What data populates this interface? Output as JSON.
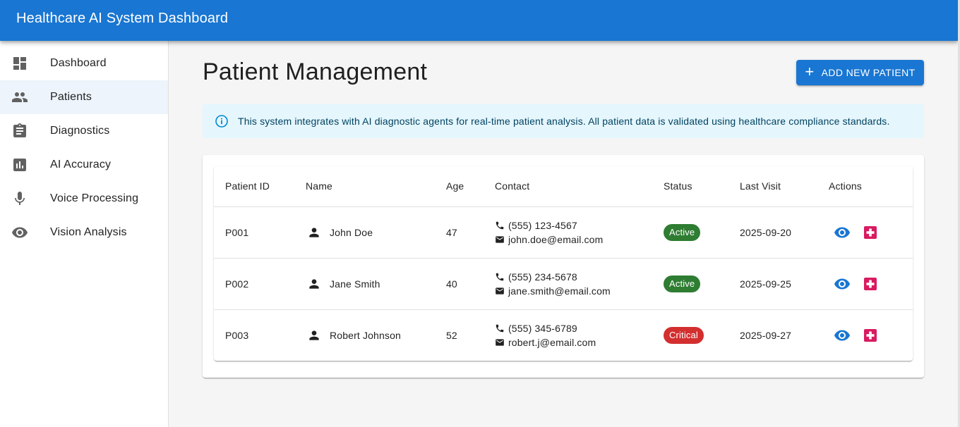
{
  "app": {
    "title": "Healthcare AI System Dashboard"
  },
  "colors": {
    "primary": "#1976d2",
    "active": "#2e7d32",
    "critical": "#d32f2f",
    "medical": "#d81b60",
    "info_text": "#014361",
    "info_bg": "#e5f6fd"
  },
  "sidebar": {
    "items": [
      {
        "label": "Dashboard",
        "icon": "dashboard-icon"
      },
      {
        "label": "Patients",
        "icon": "people-icon"
      },
      {
        "label": "Diagnostics",
        "icon": "clipboard-icon"
      },
      {
        "label": "AI Accuracy",
        "icon": "bar-chart-icon"
      },
      {
        "label": "Voice Processing",
        "icon": "microphone-icon"
      },
      {
        "label": "Vision Analysis",
        "icon": "eye-icon"
      }
    ],
    "selected": "Patients"
  },
  "main": {
    "title": "Patient Management",
    "add_button_label": "Add New Patient",
    "info_alert": "This system integrates with AI diagnostic agents for real-time patient analysis. All patient data is validated using healthcare compliance standards."
  },
  "table": {
    "headers": [
      "Patient ID",
      "Name",
      "Age",
      "Contact",
      "Status",
      "Last Visit",
      "Actions"
    ],
    "rows": [
      {
        "id": "P001",
        "name": "John Doe",
        "age": "47",
        "phone": "(555) 123-4567",
        "email": "john.doe@email.com",
        "status": "Active",
        "last_visit": "2025-09-20"
      },
      {
        "id": "P002",
        "name": "Jane Smith",
        "age": "40",
        "phone": "(555) 234-5678",
        "email": "jane.smith@email.com",
        "status": "Active",
        "last_visit": "2025-09-25"
      },
      {
        "id": "P003",
        "name": "Robert Johnson",
        "age": "52",
        "phone": "(555) 345-6789",
        "email": "robert.j@email.com",
        "status": "Critical",
        "last_visit": "2025-09-27"
      }
    ]
  }
}
